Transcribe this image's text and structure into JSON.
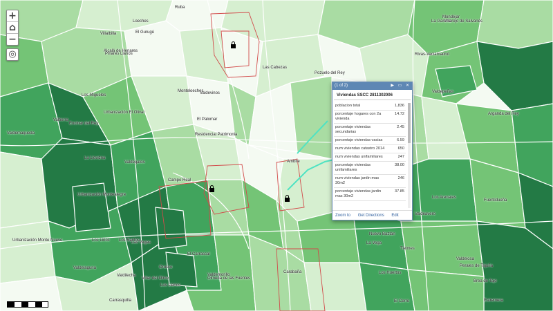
{
  "controls": {
    "zoom_in": "+",
    "home": "⌂",
    "zoom_out": "−",
    "locate": "◎"
  },
  "labels": [
    "Ruba",
    "Loeches",
    "Villalbilla",
    "El Gurugú",
    "Alcalá de Henares",
    "Pinares Llanos",
    "Los Migueles",
    "Monteloeches",
    "Valdevinos",
    "Rivas-Vaciamadrid",
    "La Garena",
    "Pozuelo del Rey",
    "Urbanización El Olivar",
    "Valtierra",
    "Encinar del Rey",
    "Arganda del Rey",
    "Residencial Patrimonia",
    "El Palomar",
    "Valdegatos",
    "La Llovizna",
    "Urbanización Montealegre",
    "Los Lirios",
    "Las Vegas",
    "Campo Real",
    "Los Santos",
    "Urbanización Monte Nuevo",
    "Valdelaguna",
    "Valdilecha",
    "Orusco",
    "El Carrascal",
    "Carrasquilla",
    "Los Llanos",
    "Villar del Olmo",
    "Olmeda de las Fuentes",
    "Ambite",
    "Los Arenales",
    "Nuevo Baztán",
    "Tielmes",
    "Perales de Tajuña",
    "Valdeavero",
    "Carabaña",
    "Valdelosa",
    "La Vega",
    "Las Cabezas",
    "Villarejo de Salvanés",
    "Valdepeñas",
    "Fuentidueña",
    "Los Huertos",
    "Brea de Tajo",
    "Estremera",
    "El Cerro",
    "Valdemaqueda",
    "Mondéjar",
    "Valdemorillo"
  ],
  "popup": {
    "pager": "(1 of 2)",
    "title": "Viviendas SSCC 2811302006",
    "rows": [
      {
        "label": "poblacion total",
        "value": "1,836"
      },
      {
        "label": "porcentaje hogares con 2a vivienda",
        "value": "14.72"
      },
      {
        "label": "porcentaje viviendas secundarias",
        "value": "2.45"
      },
      {
        "label": "porcentaje viviendas vacias",
        "value": "6.59"
      },
      {
        "label": "num viviendas catastro 2014",
        "value": "650"
      },
      {
        "label": "num viviendas unifamiliares",
        "value": "247"
      },
      {
        "label": "porcentaje viviendas unifamiliares",
        "value": "38.00"
      },
      {
        "label": "num viviendas jardin mas 30m2",
        "value": "246"
      },
      {
        "label": "porcentaje viviendas jardin mas 30m2",
        "value": "37.85"
      }
    ],
    "actions": {
      "zoom_to": "Zoom to",
      "directions": "Get Directions",
      "edit": "Edit"
    },
    "head_controls": "▶ ▭ ✕"
  },
  "colors": {
    "green_1": "#f4faf2",
    "green_2": "#d6efd0",
    "green_3": "#a9dca3",
    "green_4": "#74c476",
    "green_5": "#41a45d",
    "green_6": "#237a45",
    "boundary": "#d24a4a",
    "road_white": "#ffffff",
    "popup_header": "#5e87b4"
  }
}
